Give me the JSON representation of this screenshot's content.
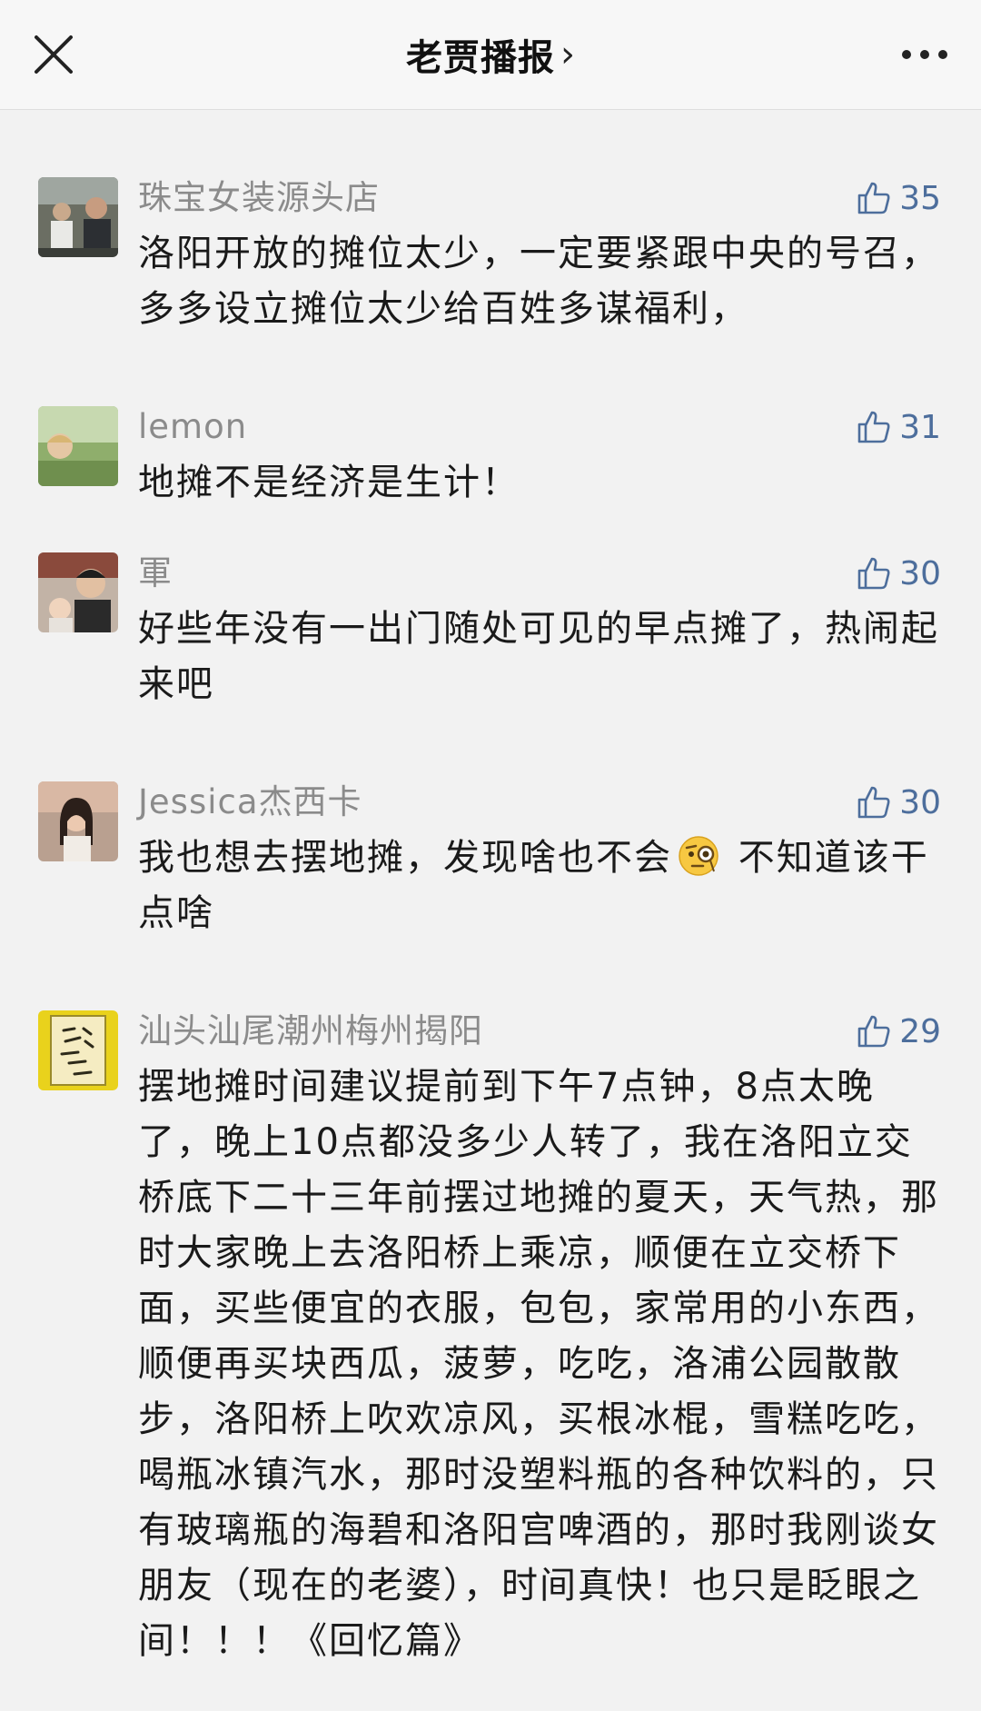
{
  "header": {
    "title": "老贾播报",
    "arrow": "›",
    "close_icon": "close-icon",
    "more_icon": "more-dots-icon"
  },
  "colors": {
    "name": "#8b8b8b",
    "like": "#4d6e9c",
    "background": "#f2f2f2"
  },
  "comments": [
    {
      "name": "珠宝女装源头店",
      "likes": "35",
      "text": "洛阳开放的摊位太少，一定要紧跟中央的号召，多多设立摊位太少给百姓多谋福利，"
    },
    {
      "name": "lemon",
      "likes": "31",
      "text": "地摊不是经济是生计！"
    },
    {
      "name": "軍",
      "likes": "30",
      "text": "好些年没有一出门随处可见的早点摊了，热闹起来吧"
    },
    {
      "name": "Jessica杰西卡",
      "likes": "30",
      "text_before": "我也想去摆地摊，发现啥也不会",
      "emoji": "monocle-face-icon",
      "text_after": " 不知道该干点啥"
    },
    {
      "name": "汕头汕尾潮州梅州揭阳",
      "likes": "29",
      "text": "摆地摊时间建议提前到下午7点钟，8点太晚了，晚上10点都没多少人转了，我在洛阳立交桥底下二十三年前摆过地摊的夏天，天气热，那时大家晚上去洛阳桥上乘凉，顺便在立交桥下面，买些便宜的衣服，包包，家常用的小东西，顺便再买块西瓜，菠萝，吃吃，洛浦公园散散步，洛阳桥上吹欢凉风，买根冰棍，雪糕吃吃，喝瓶冰镇汽水，那时没塑料瓶的各种饮料的，只有玻璃瓶的海碧和洛阳宫啤酒的，那时我刚谈女朋友（现在的老婆），时间真快！也只是眨眼之间！！！《回忆篇》"
    }
  ]
}
